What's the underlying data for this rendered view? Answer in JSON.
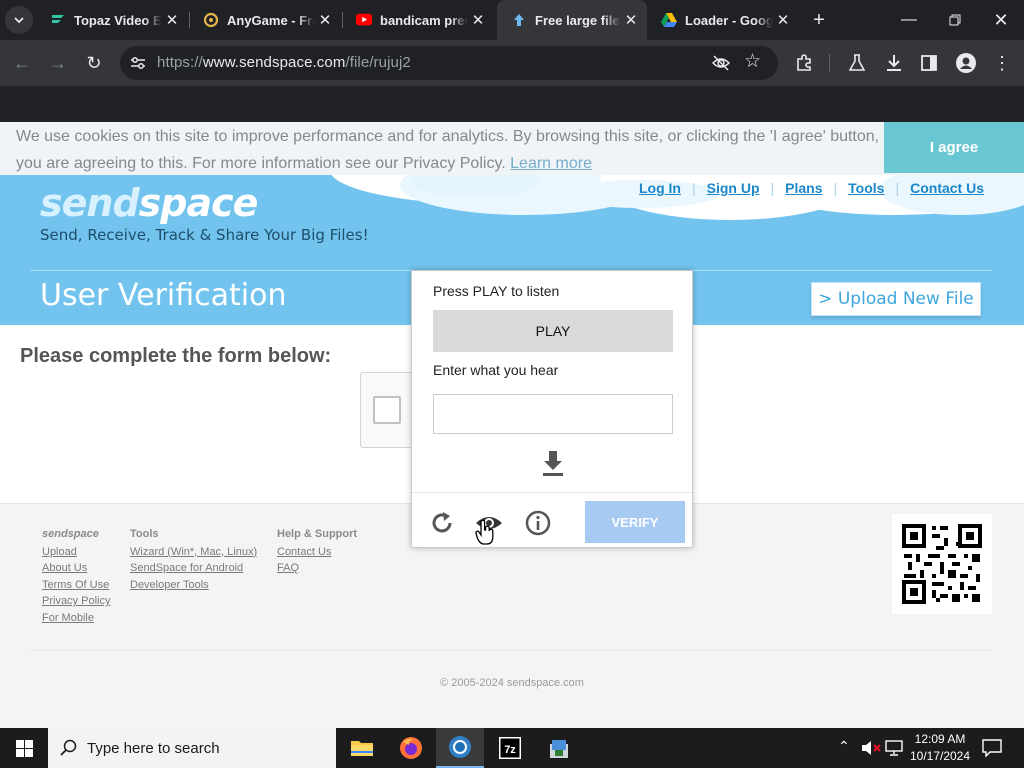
{
  "browser": {
    "tabs": [
      {
        "title": "Topaz Video Enhance AI",
        "active": false,
        "icon": "topaz-icon"
      },
      {
        "title": "AnyGame - Free",
        "active": false,
        "icon": "anygame-icon"
      },
      {
        "title": "bandicam premium",
        "active": false,
        "icon": "youtube-icon"
      },
      {
        "title": "Free large file hosting",
        "active": true,
        "icon": "sendspace-icon"
      },
      {
        "title": "Loader - Google Drive",
        "active": false,
        "icon": "google-drive-icon"
      }
    ],
    "url_scheme": "https://",
    "url_host": "www.sendspace.com",
    "url_path": "/file/rujuj2"
  },
  "cookie": {
    "text": "We use cookies on this site to improve performance and for analytics. By browsing this site, or clicking the 'I agree' button, you are agreeing to this. For more information see our Privacy Policy.",
    "learn_more": "Learn more",
    "agree": "I agree"
  },
  "header": {
    "logo_a": "send",
    "logo_b": "space",
    "tagline": "Send, Receive, Track & Share Your Big Files!",
    "nav": [
      "Log In",
      "Sign Up",
      "Plans",
      "Tools",
      "Contact Us"
    ],
    "page_title": "User Verification",
    "upload_button": "> Upload New File"
  },
  "main": {
    "form_label": "Please complete the form below:"
  },
  "captcha": {
    "press_play": "Press PLAY to listen",
    "play": "PLAY",
    "enter": "Enter what you hear",
    "verify": "VERIFY"
  },
  "footer": {
    "col1": {
      "heading": "sendspace",
      "links": [
        "Upload",
        "About Us",
        "Terms Of Use",
        "Privacy Policy",
        "For Mobile"
      ]
    },
    "col2": {
      "heading": "Tools",
      "links": [
        "Wizard (Win*, Mac, Linux)",
        "SendSpace for Android",
        "Developer Tools"
      ]
    },
    "col3": {
      "heading": "Help & Support",
      "links": [
        "Contact Us",
        "FAQ"
      ]
    },
    "copyright": "© 2005-2024 sendspace.com"
  },
  "taskbar": {
    "search_placeholder": "Type here to search",
    "time": "12:09 AM",
    "date": "10/17/2024"
  },
  "colors": {
    "accent": "#5ec3d1",
    "header_blue": "#72c4ee",
    "link_blue": "#1b87c9",
    "verify": "#a6caf2"
  }
}
